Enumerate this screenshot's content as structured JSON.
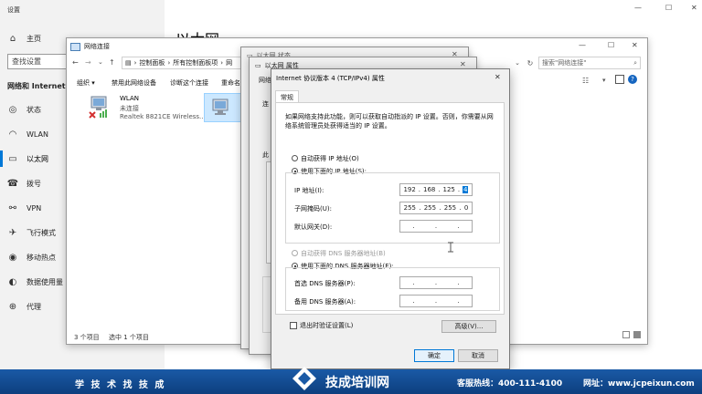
{
  "settings": {
    "title": "设置",
    "home": "主页",
    "search_placeholder": "查找设置",
    "section": "网络和 Internet",
    "nav": [
      "状态",
      "WLAN",
      "以太网",
      "拨号",
      "VPN",
      "飞行模式",
      "移动热点",
      "数据使用量",
      "代理"
    ],
    "page_title": "以太网"
  },
  "netconn": {
    "title": "网络连接",
    "breadcrumb": [
      "控制面板",
      "所有控制面板项",
      "网"
    ],
    "search_placeholder": "搜索\"网络连接\"",
    "toolbar": [
      "组织 ▾",
      "禁用此网络设备",
      "诊断这个连接",
      "重命名"
    ],
    "wlan": {
      "name": "WLAN",
      "status": "未连接",
      "adapter": "Realtek 8821CE Wireless..."
    },
    "status_items": "3 个项目",
    "status_selected": "选中 1 个项目"
  },
  "ethstatus": {
    "title": "以太网 状态"
  },
  "ethprops": {
    "title": "以太网 属性",
    "tab": "网络",
    "label_connect": "连",
    "label_this": "此"
  },
  "ipv4": {
    "title": "Internet 协议版本 4 (TCP/IPv4) 属性",
    "tab": "常规",
    "intro": "如果网络支持此功能，则可以获取自动指派的 IP 设置。否则，你需要从网络系统管理员处获得适当的 IP 设置。",
    "auto_ip": "自动获得 IP 地址(O)",
    "manual_ip": "使用下面的 IP 地址(S):",
    "ip_label": "IP 地址(I):",
    "ip_value": [
      "192",
      "168",
      "125",
      "4"
    ],
    "mask_label": "子网掩码(U):",
    "mask_value": [
      "255",
      "255",
      "255",
      "0"
    ],
    "gateway_label": "默认网关(D):",
    "auto_dns": "自动获得 DNS 服务器地址(B)",
    "manual_dns": "使用下面的 DNS 服务器地址(E):",
    "dns1_label": "首选 DNS 服务器(P):",
    "dns2_label": "备用 DNS 服务器(A):",
    "validate": "退出时验证设置(L)",
    "advanced": "高级(V)...",
    "ok": "确定",
    "cancel": "取消"
  },
  "footer": {
    "slogan": "学 技 术  找 技 成",
    "brand": "技成培训网",
    "hotline": "客服热线：400-111-4100",
    "website": "网址：www.jcpeixun.com"
  }
}
